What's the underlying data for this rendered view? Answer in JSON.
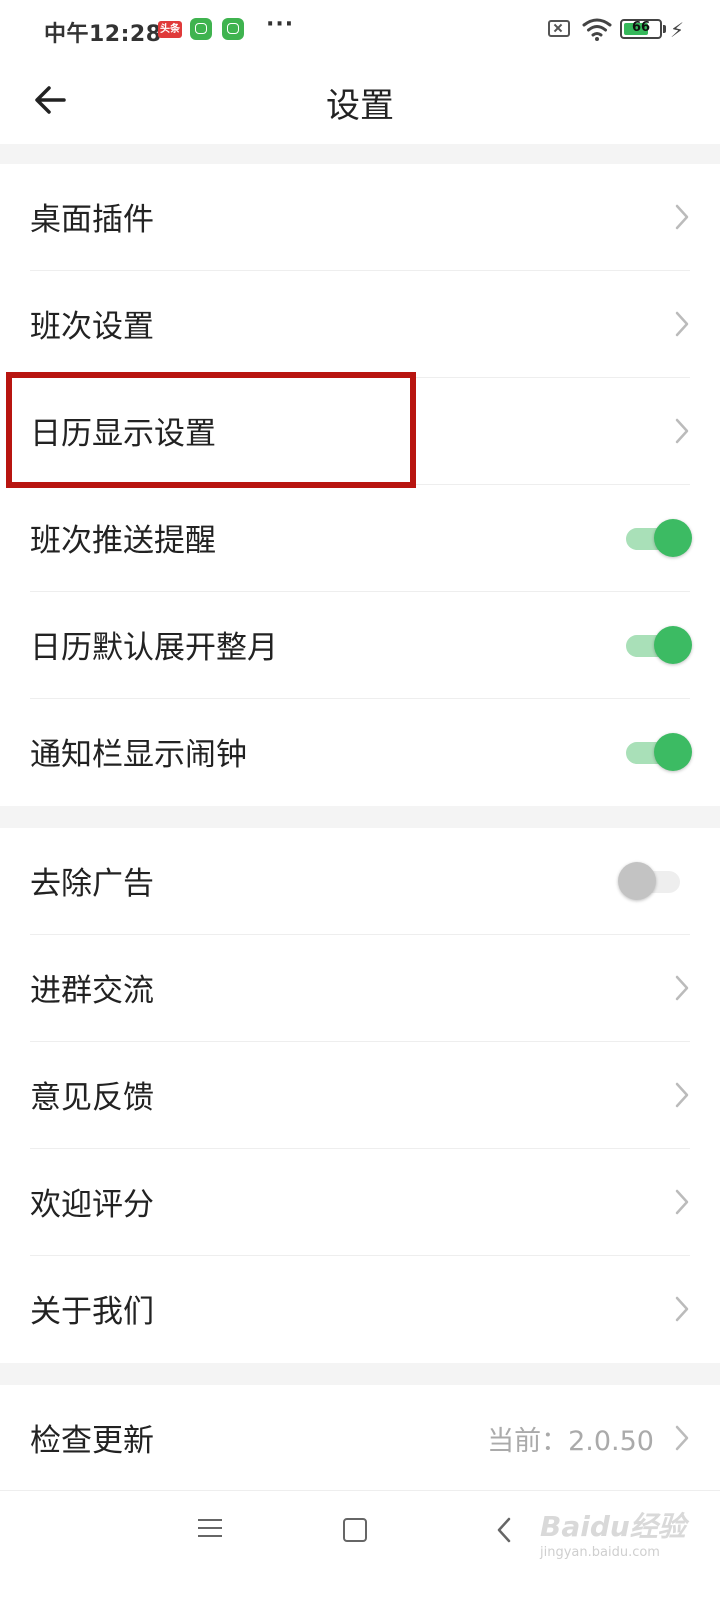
{
  "status_bar": {
    "time": "中午12:28",
    "notification_badge": "头条",
    "more": "···",
    "battery": "66"
  },
  "header": {
    "title": "设置"
  },
  "sections": [
    {
      "items": [
        {
          "label": "桌面插件",
          "control": "chevron"
        },
        {
          "label": "班次设置",
          "control": "chevron"
        },
        {
          "label": "日历显示设置",
          "control": "chevron"
        },
        {
          "label": "班次推送提醒",
          "control": "toggle",
          "on": true
        },
        {
          "label": "日历默认展开整月",
          "control": "toggle",
          "on": true
        },
        {
          "label": "通知栏显示闹钟",
          "control": "toggle",
          "on": true
        }
      ]
    },
    {
      "items": [
        {
          "label": "去除广告",
          "control": "toggle",
          "on": false
        },
        {
          "label": "进群交流",
          "control": "chevron"
        },
        {
          "label": "意见反馈",
          "control": "chevron"
        },
        {
          "label": "欢迎评分",
          "control": "chevron"
        },
        {
          "label": "关于我们",
          "control": "chevron"
        }
      ]
    },
    {
      "items": [
        {
          "label": "检查更新",
          "control": "chevron",
          "value": "当前：2.0.50"
        }
      ]
    }
  ],
  "watermark": {
    "text": "Baidu经验",
    "sub": "jingyan.baidu.com"
  },
  "colors": {
    "accent": "#3cbb63",
    "highlight": "#b81510",
    "background_gap": "#f4f4f4"
  }
}
